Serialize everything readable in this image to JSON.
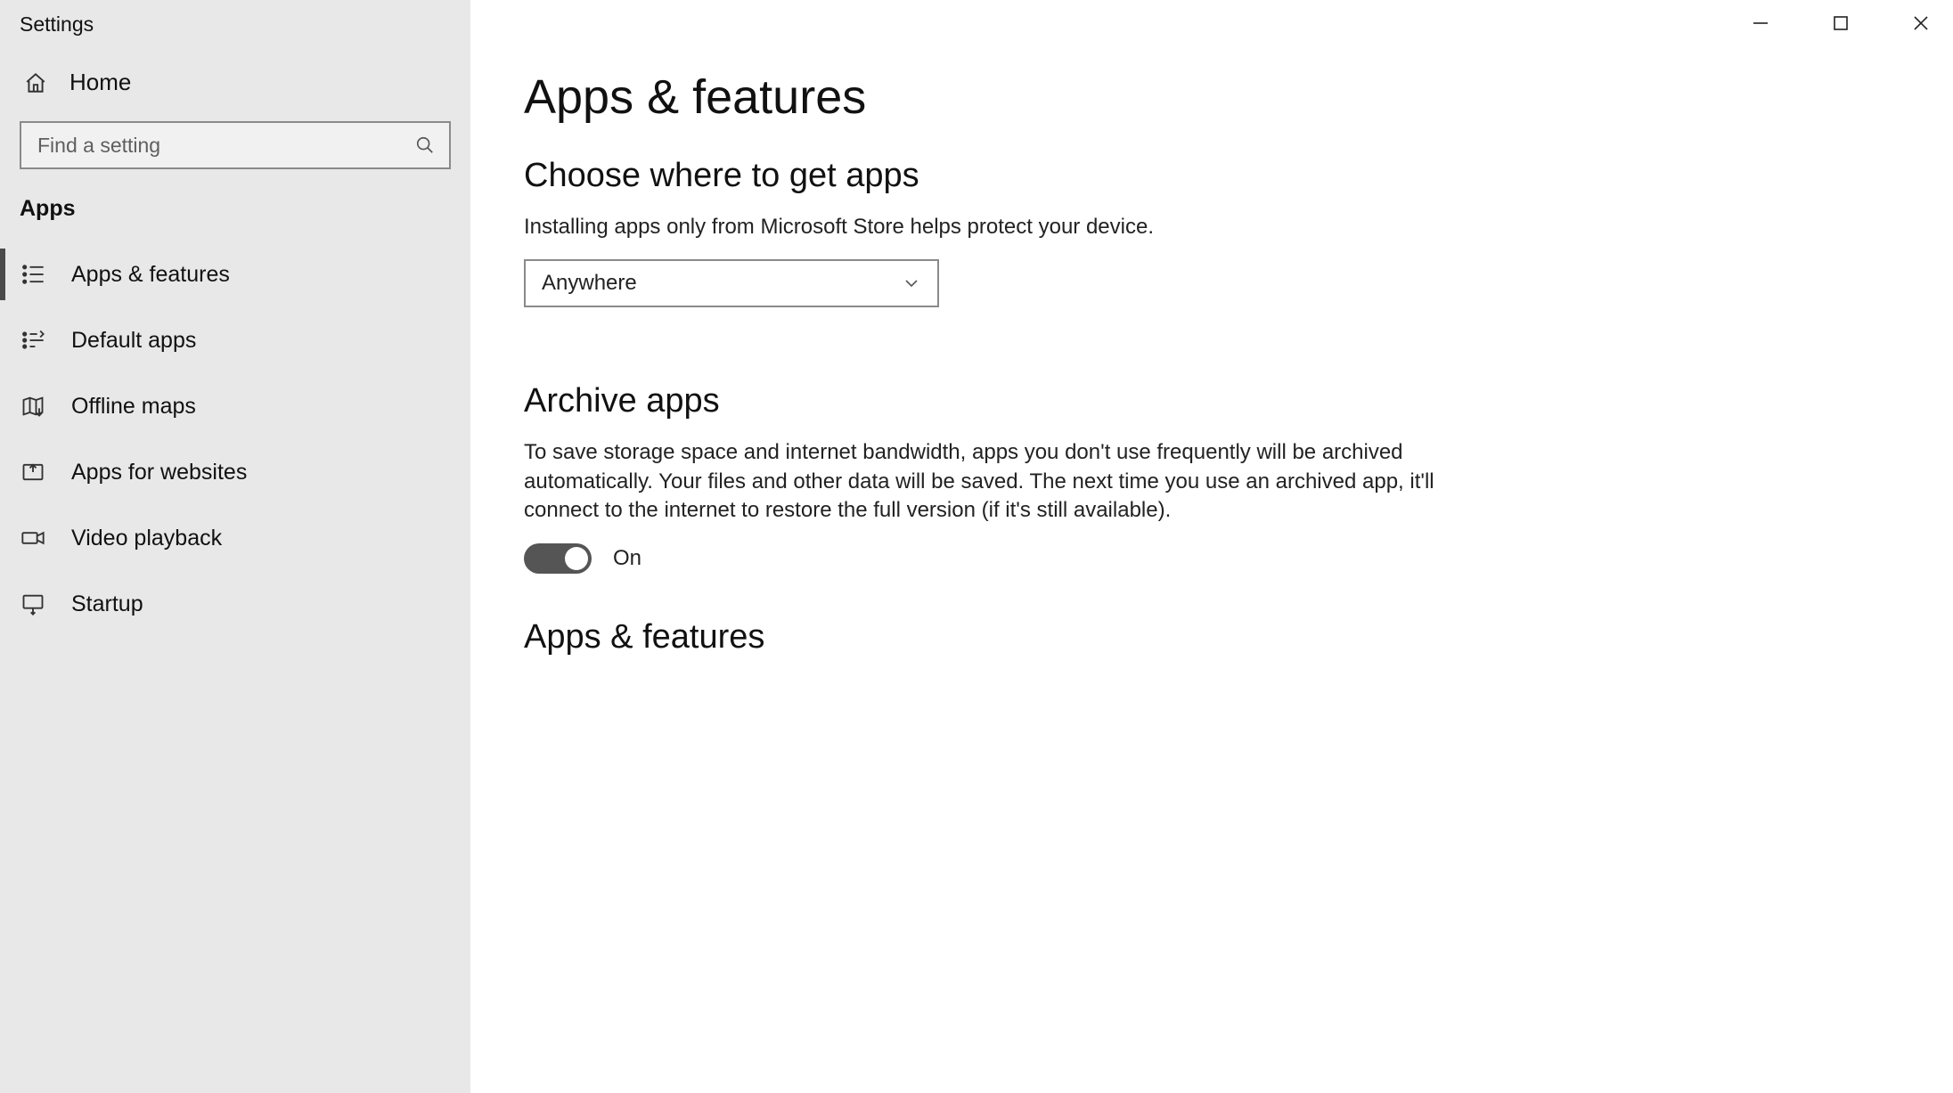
{
  "window": {
    "title": "Settings"
  },
  "sidebar": {
    "home": "Home",
    "search_placeholder": "Find a setting",
    "section": "Apps",
    "items": [
      {
        "label": "Apps & features",
        "active": true
      },
      {
        "label": "Default apps",
        "active": false
      },
      {
        "label": "Offline maps",
        "active": false
      },
      {
        "label": "Apps for websites",
        "active": false
      },
      {
        "label": "Video playback",
        "active": false
      },
      {
        "label": "Startup",
        "active": false
      }
    ]
  },
  "main": {
    "title": "Apps & features",
    "section1": {
      "heading": "Choose where to get apps",
      "text": "Installing apps only from Microsoft Store helps protect your device.",
      "dropdown_value": "Anywhere"
    },
    "section2": {
      "heading": "Archive apps",
      "text": "To save storage space and internet bandwidth, apps you don't use frequently will be archived automatically. Your files and other data will be saved. The next time you use an archived app, it'll connect to the internet to restore the full version (if it's still available).",
      "toggle_state": "On"
    },
    "section3": {
      "heading": "Apps & features"
    }
  }
}
